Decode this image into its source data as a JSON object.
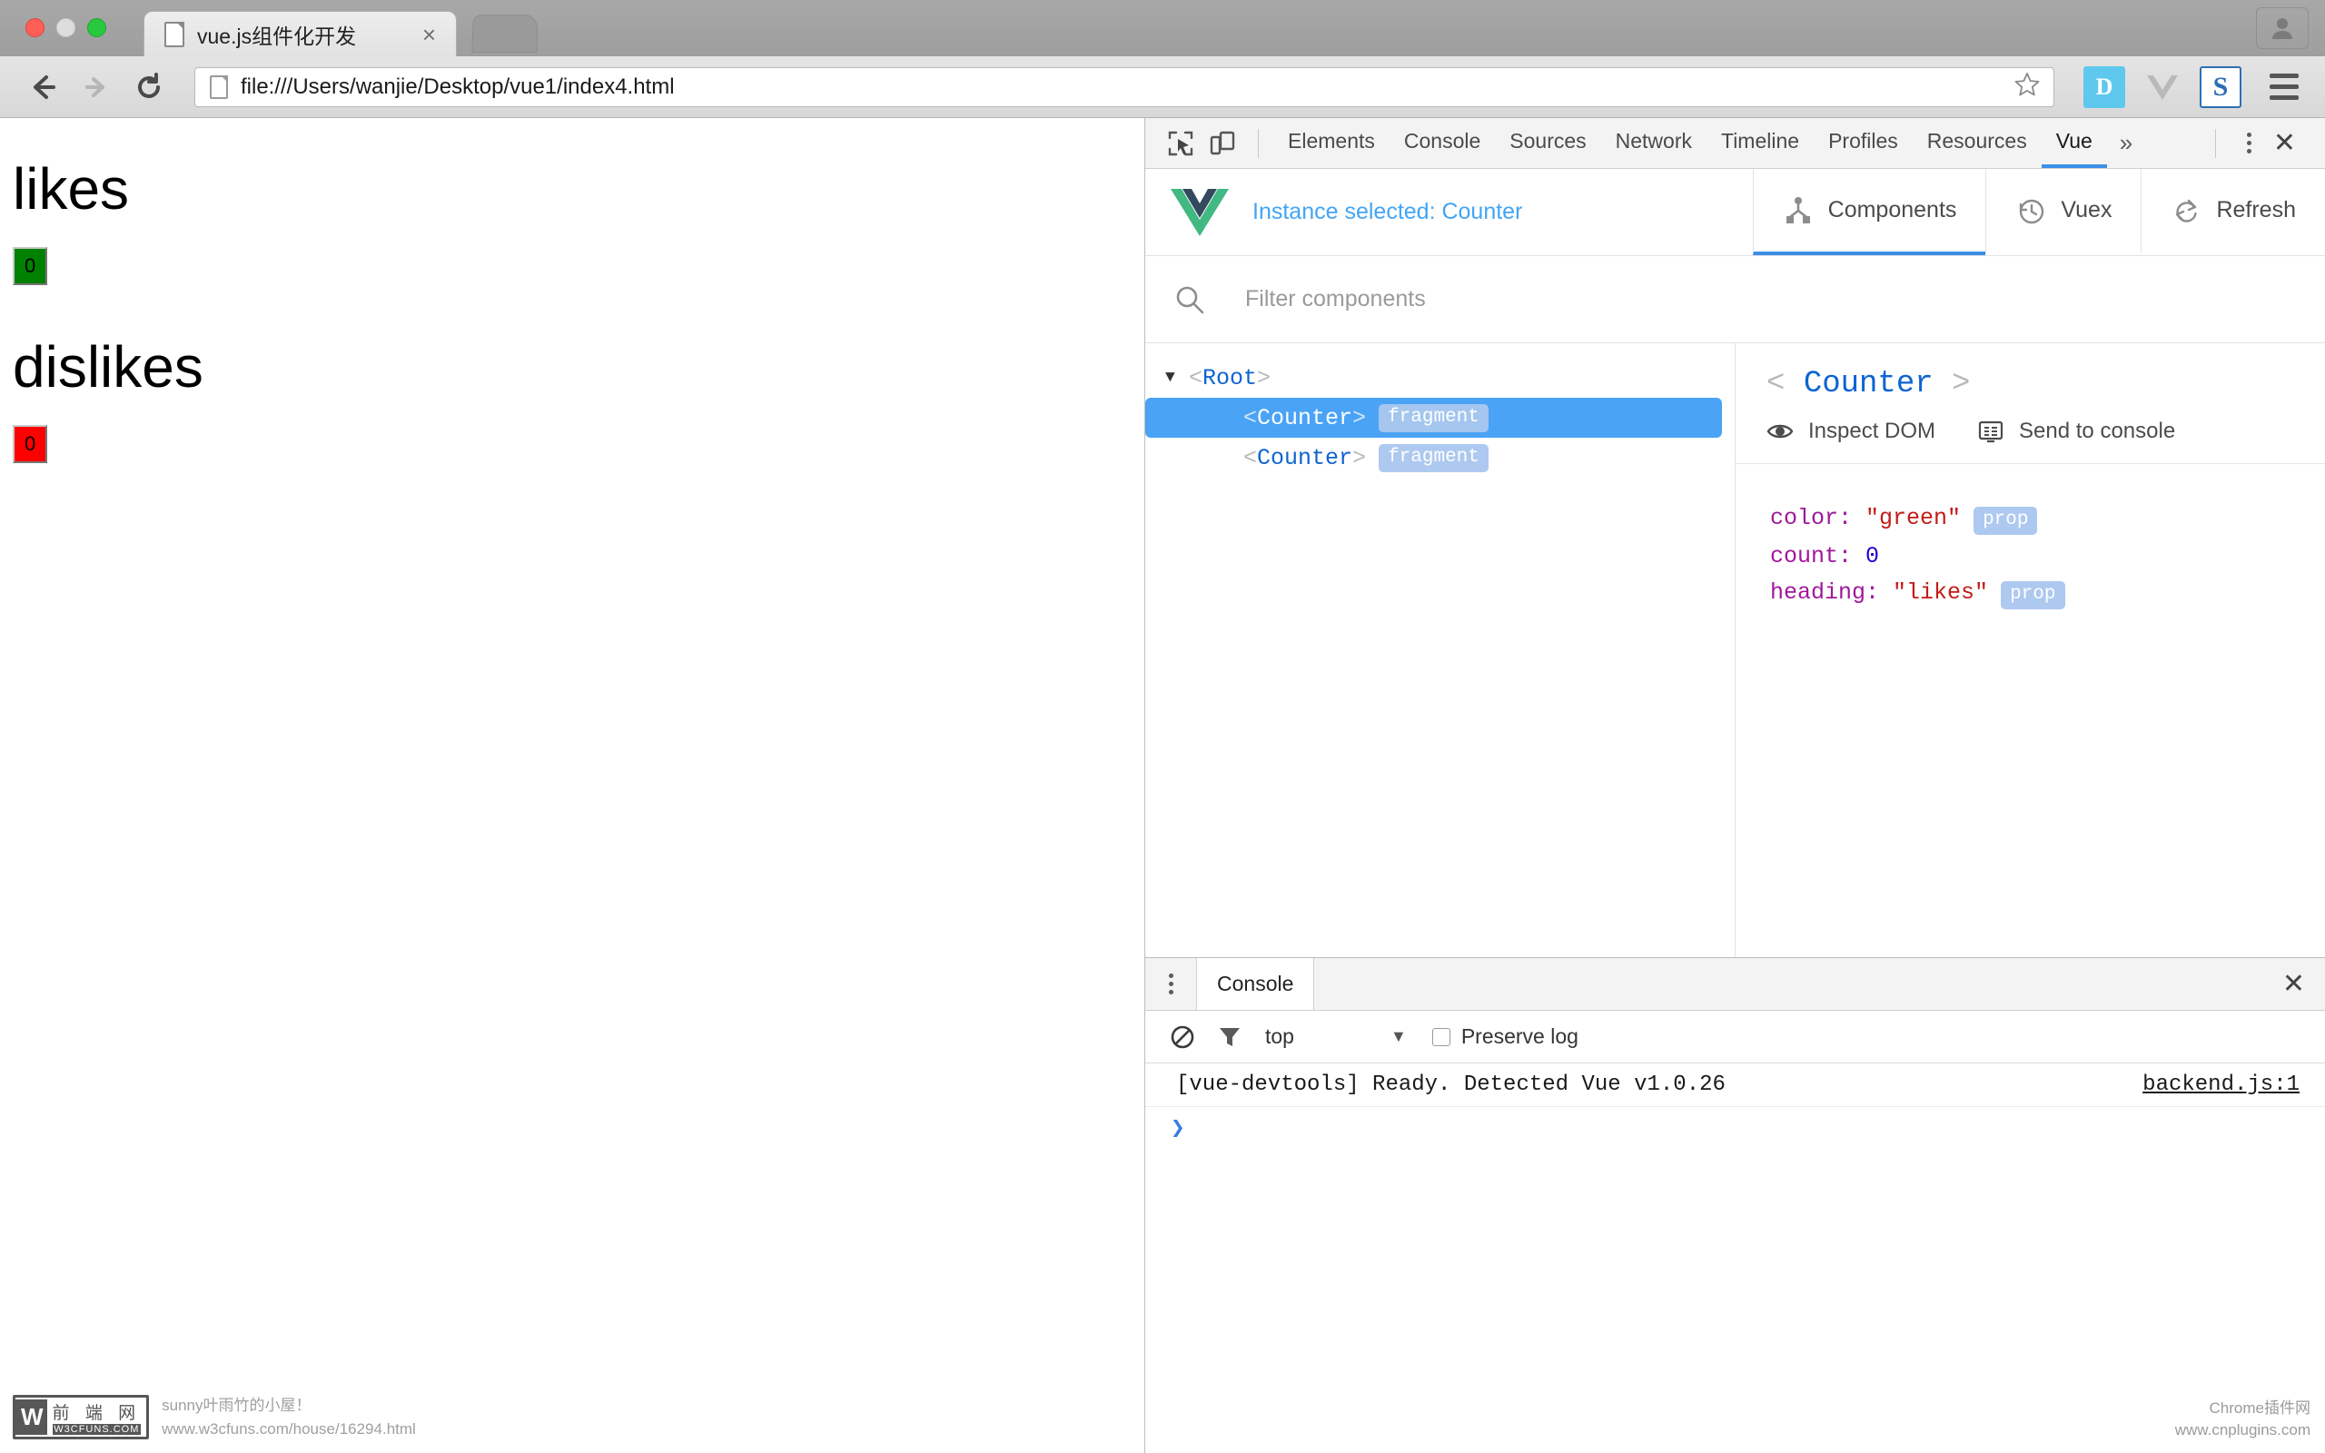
{
  "browser": {
    "tab": {
      "title": "vue.js组件化开发",
      "close_label": "×",
      "favicon": "page-icon"
    },
    "omnibox": {
      "url": "file:///Users/wanjie/Desktop/vue1/index4.html",
      "star": "star-icon"
    },
    "extensions": [
      {
        "name": "dash-extension",
        "label": "D"
      },
      {
        "name": "vue-extension",
        "label": "V"
      },
      {
        "name": "s-extension",
        "label": "S"
      }
    ],
    "nav": {
      "back": "back-icon",
      "forward": "forward-icon",
      "reload": "reload-icon"
    },
    "menu_label": "chrome-menu"
  },
  "page": {
    "sections": [
      {
        "heading": "likes",
        "count": "0",
        "color": "#008000"
      },
      {
        "heading": "dislikes",
        "count": "0",
        "color": "#ff0000"
      }
    ],
    "watermark": {
      "logo_cn": "前 端 网",
      "logo_en": "W3CFUNS.COM",
      "line1": "sunny叶雨竹的小屋！",
      "line2": "www.w3cfuns.com/house/16294.html"
    }
  },
  "devtools": {
    "tabs": [
      {
        "label": "Elements",
        "active": false
      },
      {
        "label": "Console",
        "active": false
      },
      {
        "label": "Sources",
        "active": false
      },
      {
        "label": "Network",
        "active": false
      },
      {
        "label": "Timeline",
        "active": false
      },
      {
        "label": "Profiles",
        "active": false
      },
      {
        "label": "Resources",
        "active": false
      },
      {
        "label": "Vue",
        "active": true
      }
    ],
    "more_label": "»",
    "close_label": "✕",
    "vue": {
      "instance_label": "Instance selected: Counter",
      "panel_tabs": [
        {
          "label": "Components",
          "icon": "components-icon",
          "active": true
        },
        {
          "label": "Vuex",
          "icon": "clock-icon",
          "active": false
        },
        {
          "label": "Refresh",
          "icon": "refresh-icon",
          "active": false
        }
      ],
      "filter_placeholder": "Filter components",
      "filter_value": "",
      "tree": [
        {
          "name": "Root",
          "depth": 0,
          "caret": "▼",
          "badge": "",
          "selected": false
        },
        {
          "name": "Counter",
          "depth": 1,
          "caret": "",
          "badge": "fragment",
          "selected": true
        },
        {
          "name": "Counter",
          "depth": 1,
          "caret": "",
          "badge": "fragment",
          "selected": false
        }
      ],
      "detail": {
        "open_angle": "<",
        "name": "Counter",
        "close_angle": ">",
        "actions": [
          {
            "label": "Inspect DOM",
            "icon": "eye-icon"
          },
          {
            "label": "Send to console",
            "icon": "console-icon"
          }
        ],
        "props": [
          {
            "key": "color",
            "sep": ": ",
            "value": "\"green\"",
            "vtype": "string",
            "badge": "prop"
          },
          {
            "key": "count",
            "sep": ": ",
            "value": "0",
            "vtype": "number",
            "badge": ""
          },
          {
            "key": "heading",
            "sep": ": ",
            "value": "\"likes\"",
            "vtype": "string",
            "badge": "prop"
          }
        ]
      }
    },
    "drawer": {
      "tab_label": "Console",
      "close_label": "✕",
      "context": "top",
      "caret": "▼",
      "preserve_log_label": "Preserve log",
      "preserve_log_checked": false,
      "clear_icon": "clear-icon",
      "filter_icon": "filter-icon",
      "logs": [
        {
          "text": "[vue-devtools] Ready. Detected Vue v1.0.26",
          "source": "backend.js:1"
        }
      ],
      "prompt": "❯"
    }
  },
  "watermark_right": {
    "line1": "Chrome插件网",
    "line2": "www.cnplugins.com"
  },
  "colors": {
    "accent_blue": "#3a8fe8",
    "selection_blue": "#4aa3f5",
    "vue_green": "#42b883",
    "vue_dark": "#35495e",
    "link_blue": "#42a5f5"
  }
}
